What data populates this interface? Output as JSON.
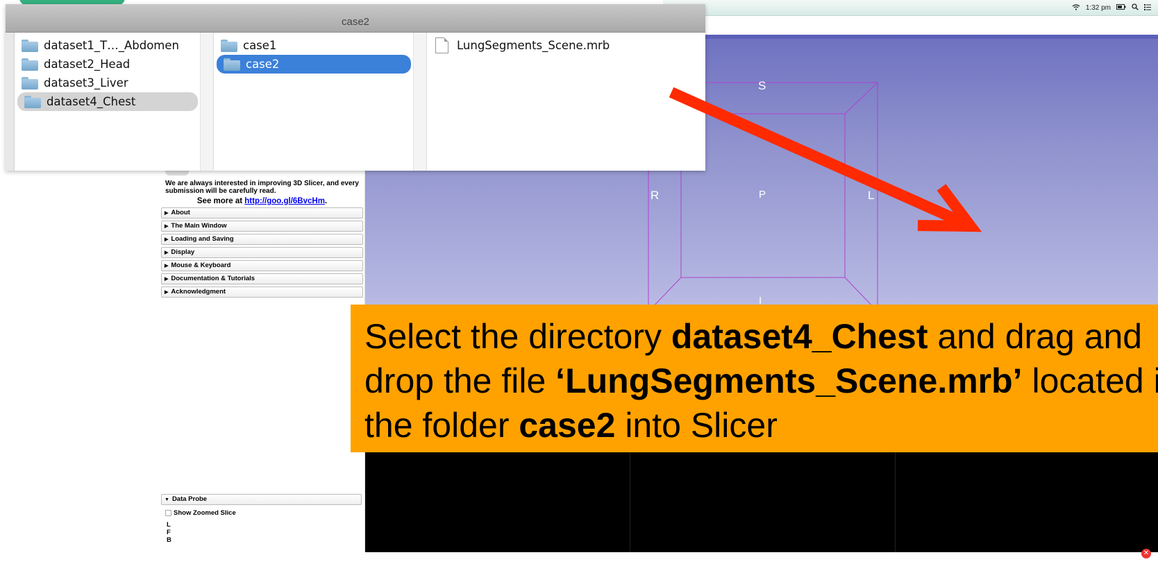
{
  "menubar": {
    "wifi_icon": "wifi-icon",
    "time": "1:32 pm",
    "battery_icon": "battery-icon",
    "search_icon": "search-icon",
    "list_icon": "list-icon"
  },
  "finder": {
    "title": "case2",
    "column1": [
      {
        "label": "dataset1_T…_Abdomen",
        "selected": false
      },
      {
        "label": "dataset2_Head",
        "selected": false
      },
      {
        "label": "dataset3_Liver",
        "selected": false
      },
      {
        "label": "dataset4_Chest",
        "selected": true
      }
    ],
    "column2": [
      {
        "label": "case1",
        "selected": false
      },
      {
        "label": "case2",
        "selected": true
      }
    ],
    "column3": [
      {
        "label": "LungSegments_Scene.mrb"
      }
    ]
  },
  "viewer3d": {
    "labels": {
      "S": "S",
      "R": "R",
      "P": "P",
      "L": "L",
      "I": "I"
    },
    "background_top": "#6e71c0",
    "background_bottom": "#b8bae3",
    "box_color": "#b040d0"
  },
  "help": {
    "intro": "We are always interested in improving 3D Slicer, and every submission will be carefully read.",
    "see_more_prefix": "See more at ",
    "see_more_link": "http://goo.gl/6BvcHm",
    "see_more_suffix": ".",
    "sections": [
      "About",
      "The Main Window",
      "Loading and Saving",
      "Display",
      "Mouse & Keyboard",
      "Documentation & Tutorials",
      "Acknowledgment"
    ],
    "data_probe": {
      "title": "Data Probe",
      "show_zoomed_slice": "Show Zoomed Slice",
      "labels": [
        "L",
        "F",
        "B"
      ]
    }
  },
  "banner": {
    "line1_a": "Select the directory ",
    "line1_b": "dataset4_Chest",
    "line1_c": " and drag and",
    "line2_a": "drop the file ",
    "line2_b": "‘LungSegments_Scene.mrb’",
    "line2_c": " located in",
    "line3_a": "the folder ",
    "line3_b": "case2",
    "line3_c": " into Slicer",
    "background": "#ffa200"
  },
  "arrow_color": "#ff2a00",
  "close_icon": "close-icon"
}
